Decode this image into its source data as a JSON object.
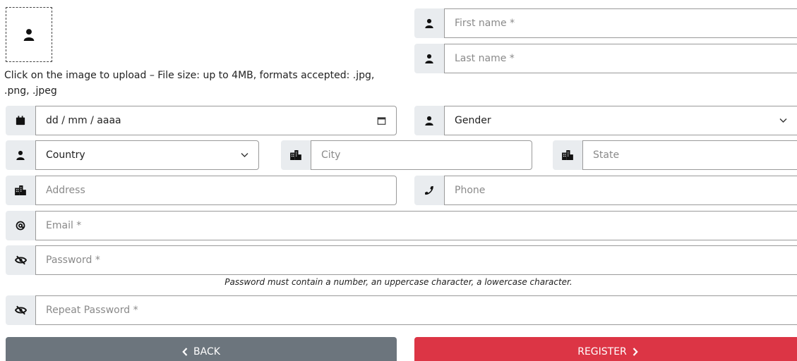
{
  "upload": {
    "note": "Click on the image to upload – File size: up to 4MB, formats accepted: .jpg, .png, .jpeg"
  },
  "fields": {
    "first_name": {
      "placeholder": "First name *"
    },
    "last_name": {
      "placeholder": "Last name *"
    },
    "birthdate": {
      "placeholder": "dd / mm / aaaa"
    },
    "gender": {
      "selected": "Gender"
    },
    "country": {
      "selected": "Country"
    },
    "city": {
      "placeholder": "City"
    },
    "state": {
      "placeholder": "State"
    },
    "address": {
      "placeholder": "Address"
    },
    "phone": {
      "placeholder": "Phone"
    },
    "email": {
      "placeholder": "Email *"
    },
    "password": {
      "placeholder": "Password *"
    },
    "password_hint": "Password must contain a number, an uppercase character, a lowercase character.",
    "repeat_password": {
      "placeholder": "Repeat Password *"
    }
  },
  "buttons": {
    "back": "BACK",
    "register": "REGISTER"
  },
  "colors": {
    "back": "#6c757d",
    "register": "#dc3545",
    "addon_bg": "#e9ecef"
  },
  "icons": {
    "avatar": "user-icon",
    "name": "user-icon",
    "date": "calendar-icon",
    "location": "building-icon",
    "phone": "phone-icon",
    "email": "at-icon",
    "password": "eye-slash-icon"
  }
}
